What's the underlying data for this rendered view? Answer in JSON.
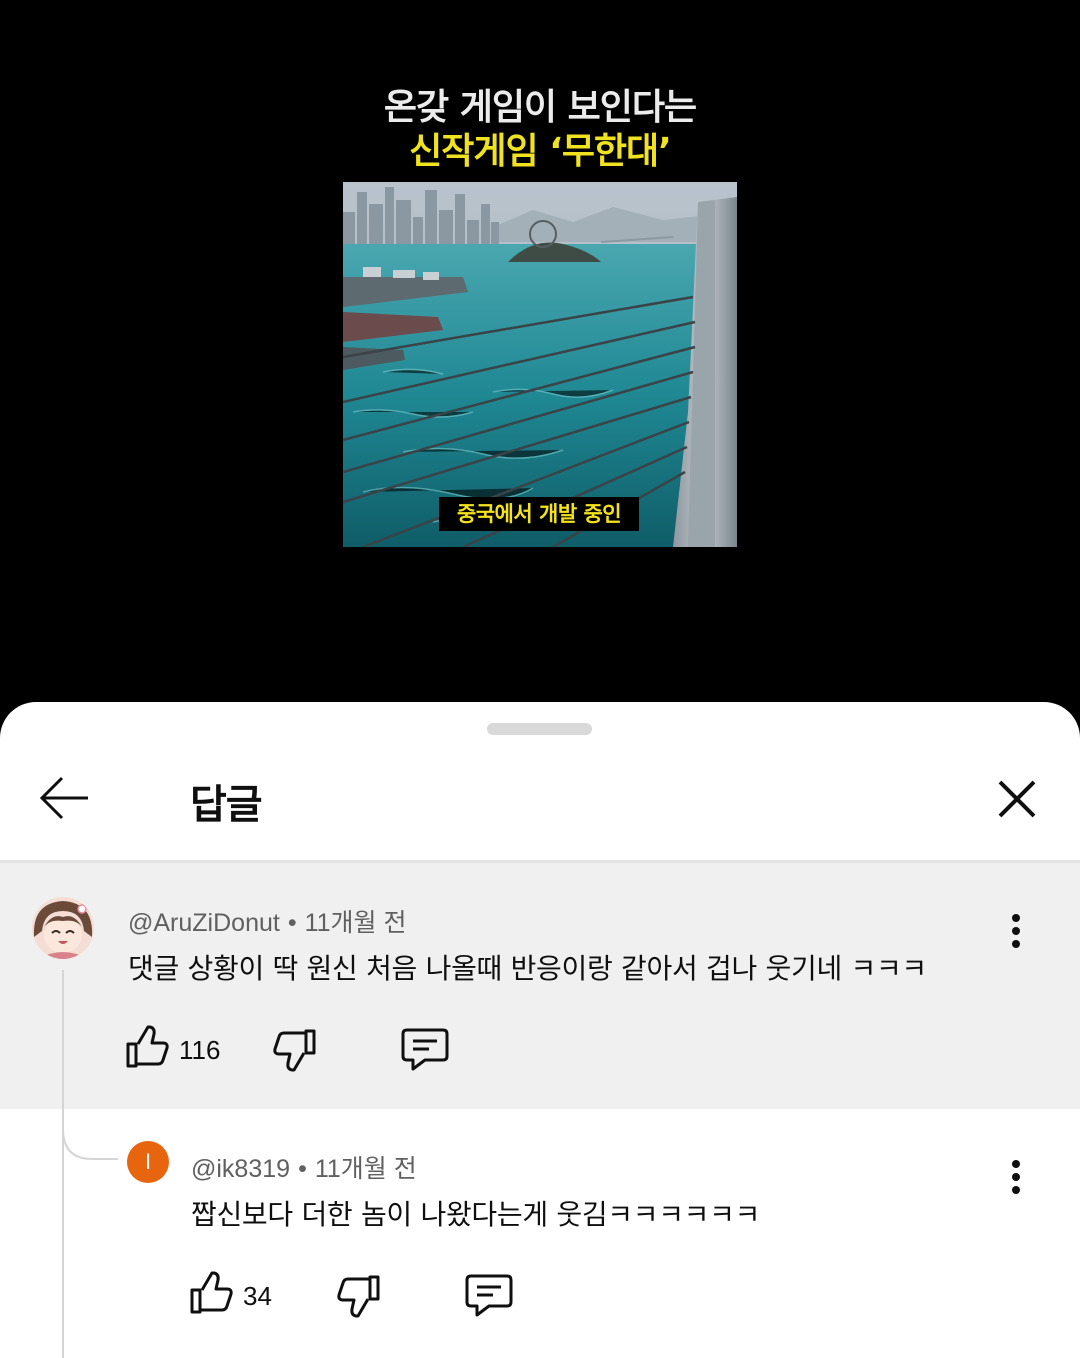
{
  "video": {
    "headline_line1": "온갖 게임이 보인다는",
    "headline_line2": "신작게임 ‘무한대’",
    "caption": "중국에서 개발 중인",
    "headline_color": "#f0e21f"
  },
  "sheet": {
    "title": "답글",
    "back_icon": "arrow-left-icon",
    "close_icon": "close-icon"
  },
  "comments": [
    {
      "author": "@AruZiDonut",
      "time": "11개월 전",
      "text": "댓글 상황이 딱 원신 처음 나올때 반응이랑 같아서 겁나 웃기네 ㅋㅋㅋ",
      "likes": "116",
      "avatar": "anime-avatar"
    },
    {
      "author": "@ik8319",
      "time": "11개월 전",
      "text": "짭신보다 더한 놈이 나왔다는게 웃김ㅋㅋㅋㅋㅋㅋ",
      "likes": "34",
      "avatar_letter": "I",
      "avatar_color": "#e8650f"
    }
  ],
  "separator": "•"
}
